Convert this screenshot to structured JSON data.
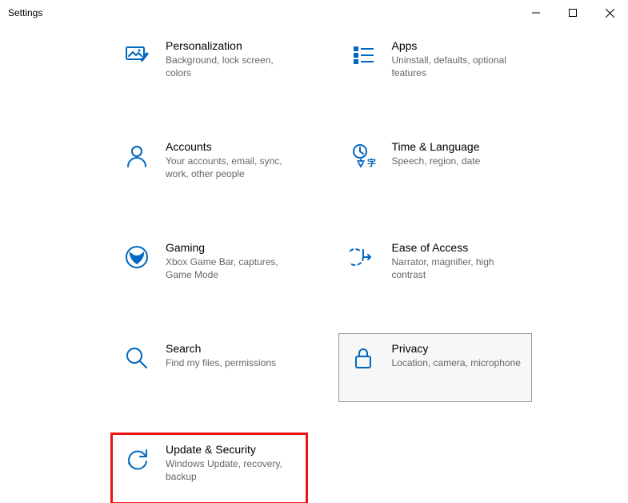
{
  "window": {
    "title": "Settings"
  },
  "categories": [
    {
      "id": "personalization",
      "icon": "personalization-icon",
      "title": "Personalization",
      "desc": "Background, lock screen, colors"
    },
    {
      "id": "apps",
      "icon": "apps-icon",
      "title": "Apps",
      "desc": "Uninstall, defaults, optional features"
    },
    {
      "id": "accounts",
      "icon": "accounts-icon",
      "title": "Accounts",
      "desc": "Your accounts, email, sync, work, other people"
    },
    {
      "id": "time-language",
      "icon": "time-language-icon",
      "title": "Time & Language",
      "desc": "Speech, region, date"
    },
    {
      "id": "gaming",
      "icon": "gaming-icon",
      "title": "Gaming",
      "desc": "Xbox Game Bar, captures, Game Mode"
    },
    {
      "id": "ease-of-access",
      "icon": "ease-of-access-icon",
      "title": "Ease of Access",
      "desc": "Narrator, magnifier, high contrast"
    },
    {
      "id": "search",
      "icon": "search-icon",
      "title": "Search",
      "desc": "Find my files, permissions"
    },
    {
      "id": "privacy",
      "icon": "privacy-icon",
      "title": "Privacy",
      "desc": "Location, camera, microphone",
      "hover": true
    },
    {
      "id": "update-security",
      "icon": "update-security-icon",
      "title": "Update & Security",
      "desc": "Windows Update, recovery, backup",
      "highlight": true
    }
  ]
}
